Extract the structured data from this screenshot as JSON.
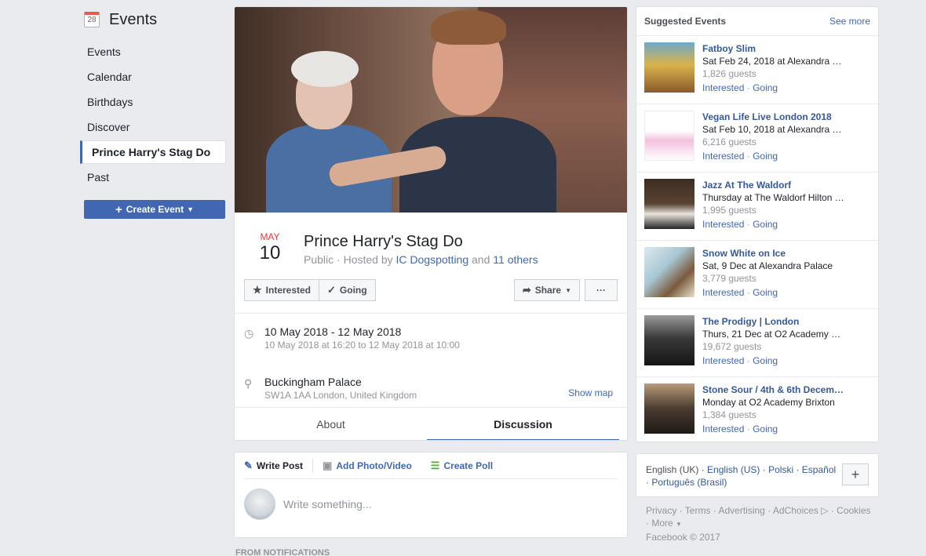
{
  "leftnav": {
    "title": "Events",
    "cal_day": "28",
    "items": [
      "Events",
      "Calendar",
      "Birthdays",
      "Discover"
    ],
    "active_item": "Prince Harry's Stag Do",
    "past": "Past",
    "create_label": "Create Event"
  },
  "event": {
    "month": "MAY",
    "day": "10",
    "title": "Prince Harry's Stag Do",
    "privacy": "Public",
    "hosted_by_prefix": "· Hosted by",
    "host": "IC Dogspotting",
    "and": "and",
    "others": "11 others",
    "interested_label": "Interested",
    "going_label": "Going",
    "share_label": "Share",
    "more_label": "···",
    "date_primary": "10 May 2018 - 12 May 2018",
    "date_secondary": "10 May 2018 at 16:20 to 12 May 2018 at 10:00",
    "location_primary": "Buckingham Palace",
    "location_secondary": "SW1A 1AA London, United Kingdom",
    "show_map": "Show map",
    "tab_about": "About",
    "tab_discussion": "Discussion"
  },
  "composer": {
    "write_post": "Write Post",
    "add_photo": "Add Photo/Video",
    "create_poll": "Create Poll",
    "placeholder": "Write something..."
  },
  "from_notifications": "FROM NOTIFICATIONS",
  "suggested": {
    "title": "Suggested Events",
    "see_more": "See more",
    "items": [
      {
        "name": "Fatboy Slim",
        "when": "Sat Feb 24, 2018 at Alexandra …",
        "guests": "1,826 guests"
      },
      {
        "name": "Vegan Life Live London 2018",
        "when": "Sat Feb 10, 2018 at Alexandra …",
        "guests": "6,216 guests"
      },
      {
        "name": "Jazz At The Waldorf",
        "when": "Thursday at The Waldorf Hilton …",
        "guests": "1,995 guests"
      },
      {
        "name": "Snow White on Ice",
        "when": "Sat, 9 Dec at Alexandra Palace",
        "guests": "3,779 guests"
      },
      {
        "name": "The Prodigy | London",
        "when": "Thurs, 21 Dec at O2 Academy …",
        "guests": "19,672 guests"
      },
      {
        "name": "Stone Sour / 4th & 6th Decem…",
        "when": "Monday at O2 Academy Brixton",
        "guests": "1,384 guests"
      }
    ],
    "interested": "Interested",
    "going": "Going",
    "sep": "·"
  },
  "languages": {
    "current": "English (UK)",
    "others": [
      "English (US)",
      "Polski",
      "Español",
      "Português (Brasil)"
    ],
    "sep": "·",
    "add": "+"
  },
  "footer": {
    "links": [
      "Privacy",
      "Terms",
      "Advertising",
      "AdChoices"
    ],
    "cookies": "Cookies",
    "more": "More",
    "copyright": "Facebook © 2017"
  },
  "colors": {
    "brand_blue": "#4267b2",
    "link_blue": "#365899",
    "date_red": "#e0393e",
    "bg": "#e9ebee"
  }
}
